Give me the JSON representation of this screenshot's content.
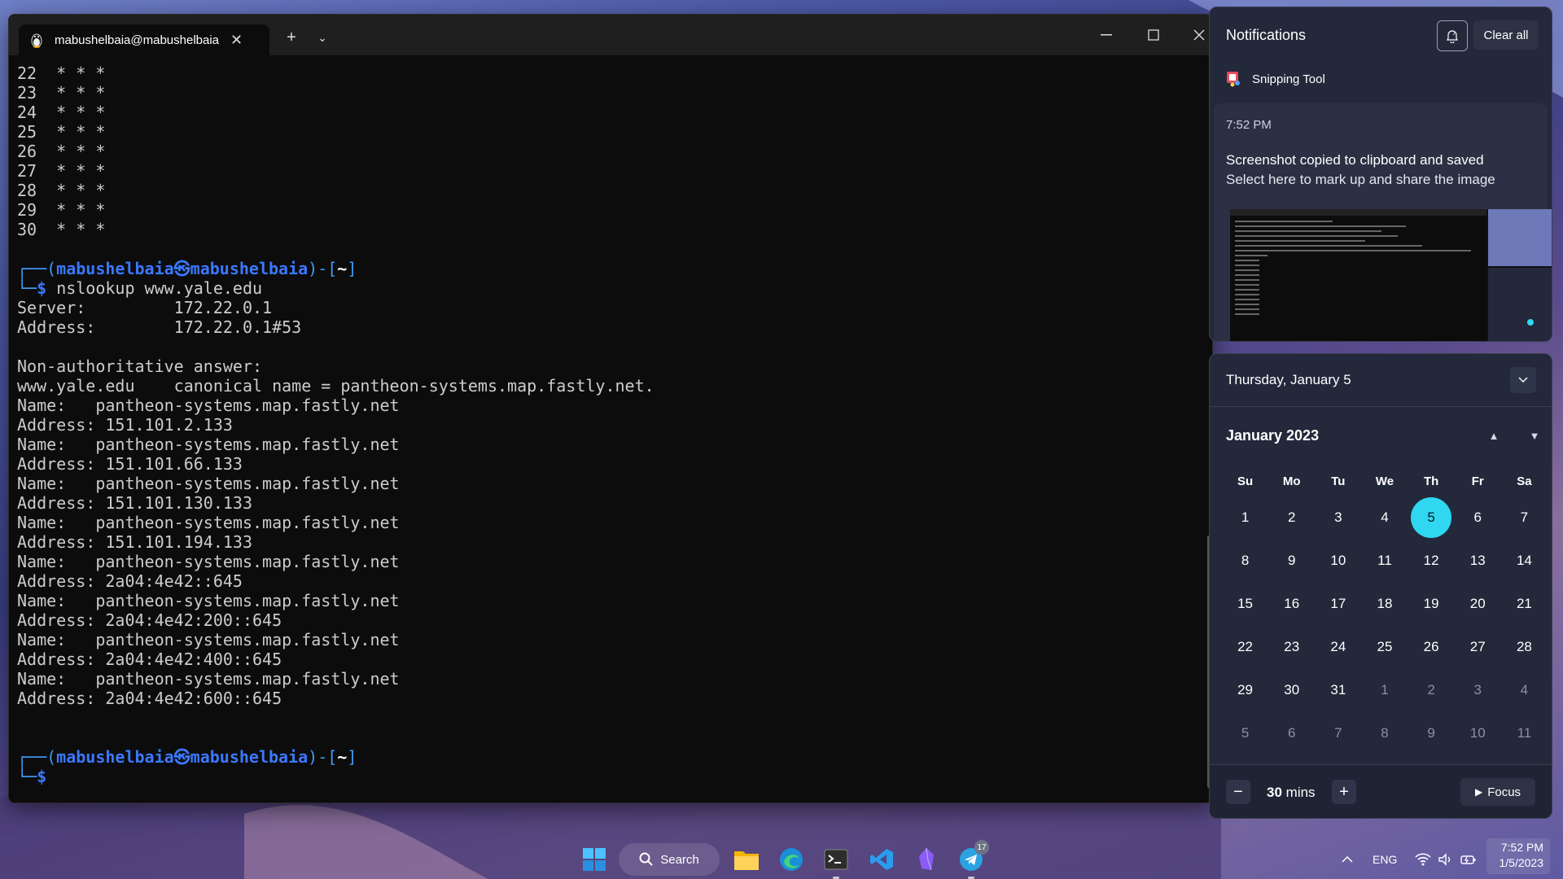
{
  "terminal": {
    "tab_title": "mabushelbaia@mabushelbaia",
    "lines": [
      {
        "type": "plain",
        "text": "22  * * *"
      },
      {
        "type": "plain",
        "text": "23  * * *"
      },
      {
        "type": "plain",
        "text": "24  * * *"
      },
      {
        "type": "plain",
        "text": "25  * * *"
      },
      {
        "type": "plain",
        "text": "26  * * *"
      },
      {
        "type": "plain",
        "text": "27  * * *"
      },
      {
        "type": "plain",
        "text": "28  * * *"
      },
      {
        "type": "plain",
        "text": "29  * * *"
      },
      {
        "type": "plain",
        "text": "30  * * *"
      },
      {
        "type": "plain",
        "text": ""
      },
      {
        "type": "prompt"
      },
      {
        "type": "command",
        "text": "nslookup www.yale.edu"
      },
      {
        "type": "plain",
        "text": "Server:         172.22.0.1"
      },
      {
        "type": "plain",
        "text": "Address:        172.22.0.1#53"
      },
      {
        "type": "plain",
        "text": ""
      },
      {
        "type": "plain",
        "text": "Non-authoritative answer:"
      },
      {
        "type": "plain",
        "text": "www.yale.edu    canonical name = pantheon-systems.map.fastly.net."
      },
      {
        "type": "plain",
        "text": "Name:   pantheon-systems.map.fastly.net"
      },
      {
        "type": "plain",
        "text": "Address: 151.101.2.133"
      },
      {
        "type": "plain",
        "text": "Name:   pantheon-systems.map.fastly.net"
      },
      {
        "type": "plain",
        "text": "Address: 151.101.66.133"
      },
      {
        "type": "plain",
        "text": "Name:   pantheon-systems.map.fastly.net"
      },
      {
        "type": "plain",
        "text": "Address: 151.101.130.133"
      },
      {
        "type": "plain",
        "text": "Name:   pantheon-systems.map.fastly.net"
      },
      {
        "type": "plain",
        "text": "Address: 151.101.194.133"
      },
      {
        "type": "plain",
        "text": "Name:   pantheon-systems.map.fastly.net"
      },
      {
        "type": "plain",
        "text": "Address: 2a04:4e42::645"
      },
      {
        "type": "plain",
        "text": "Name:   pantheon-systems.map.fastly.net"
      },
      {
        "type": "plain",
        "text": "Address: 2a04:4e42:200::645"
      },
      {
        "type": "plain",
        "text": "Name:   pantheon-systems.map.fastly.net"
      },
      {
        "type": "plain",
        "text": "Address: 2a04:4e42:400::645"
      },
      {
        "type": "plain",
        "text": "Name:   pantheon-systems.map.fastly.net"
      },
      {
        "type": "plain",
        "text": "Address: 2a04:4e42:600::645"
      },
      {
        "type": "plain",
        "text": ""
      },
      {
        "type": "plain",
        "text": ""
      },
      {
        "type": "prompt"
      },
      {
        "type": "command",
        "text": ""
      }
    ],
    "prompt": {
      "frame_open": "┌──(",
      "user": "mabushelbaia",
      "at": "㉿",
      "host": "mabushelbaia",
      "frame_mid": ")-[",
      "dir": "~",
      "frame_close": "]",
      "cmd_prefix": "└─",
      "dollar": "$"
    }
  },
  "notifications": {
    "header": "Notifications",
    "clear_all": "Clear all",
    "app_name": "Snipping Tool",
    "time": "7:52 PM",
    "title": "Screenshot copied to clipboard and saved",
    "description": "Select here to mark up and share the image"
  },
  "calendar": {
    "date_heading": "Thursday, January 5",
    "month_label": "January 2023",
    "weekdays": [
      "Su",
      "Mo",
      "Tu",
      "We",
      "Th",
      "Fr",
      "Sa"
    ],
    "weeks": [
      [
        {
          "d": "1"
        },
        {
          "d": "2"
        },
        {
          "d": "3"
        },
        {
          "d": "4"
        },
        {
          "d": "5",
          "today": true
        },
        {
          "d": "6"
        },
        {
          "d": "7"
        }
      ],
      [
        {
          "d": "8"
        },
        {
          "d": "9"
        },
        {
          "d": "10"
        },
        {
          "d": "11"
        },
        {
          "d": "12"
        },
        {
          "d": "13"
        },
        {
          "d": "14"
        }
      ],
      [
        {
          "d": "15"
        },
        {
          "d": "16"
        },
        {
          "d": "17"
        },
        {
          "d": "18"
        },
        {
          "d": "19"
        },
        {
          "d": "20"
        },
        {
          "d": "21"
        }
      ],
      [
        {
          "d": "22"
        },
        {
          "d": "23"
        },
        {
          "d": "24"
        },
        {
          "d": "25"
        },
        {
          "d": "26"
        },
        {
          "d": "27"
        },
        {
          "d": "28"
        }
      ],
      [
        {
          "d": "29"
        },
        {
          "d": "30"
        },
        {
          "d": "31"
        },
        {
          "d": "1",
          "other": true
        },
        {
          "d": "2",
          "other": true
        },
        {
          "d": "3",
          "other": true
        },
        {
          "d": "4",
          "other": true
        }
      ],
      [
        {
          "d": "5",
          "other": true
        },
        {
          "d": "6",
          "other": true
        },
        {
          "d": "7",
          "other": true
        },
        {
          "d": "8",
          "other": true
        },
        {
          "d": "9",
          "other": true
        },
        {
          "d": "10",
          "other": true
        },
        {
          "d": "11",
          "other": true
        }
      ]
    ],
    "focus_value": "30",
    "focus_unit": "mins",
    "focus_label": "Focus"
  },
  "taskbar": {
    "search_label": "Search",
    "telegram_badge": "17",
    "language": "ENG",
    "time": "7:52 PM",
    "date": "1/5/2023"
  },
  "colors": {
    "accent_today": "#2fd8f0",
    "prompt_blue": "#3b78ff",
    "terminal_bg": "#0c0c0c"
  }
}
